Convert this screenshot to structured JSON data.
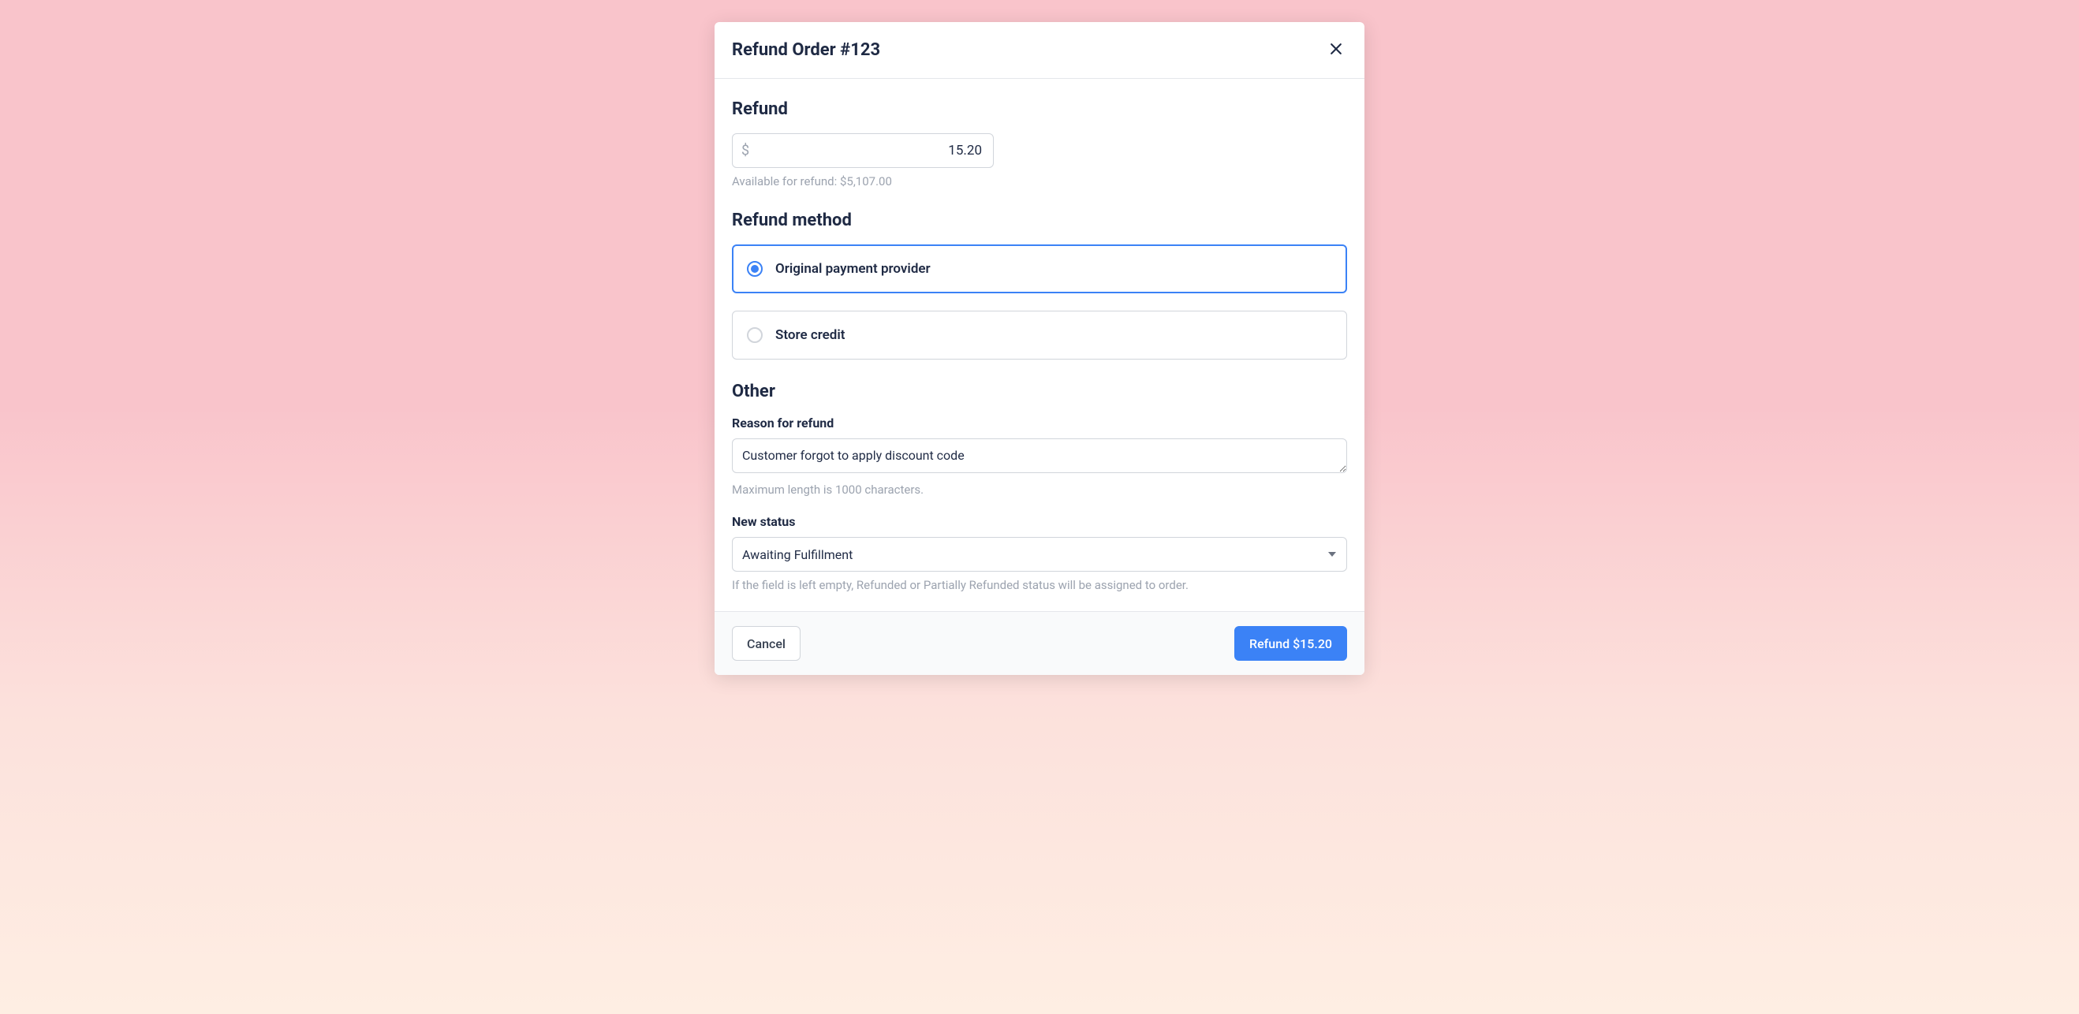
{
  "modal": {
    "title": "Refund Order #123",
    "sections": {
      "refund_title": "Refund",
      "method_title": "Refund method",
      "other_title": "Other"
    },
    "amount": {
      "currency_symbol": "$",
      "value": "15.20",
      "available_text": "Available for refund: $5,107.00"
    },
    "methods": {
      "original": "Original payment provider",
      "store_credit": "Store credit"
    },
    "reason": {
      "label": "Reason for refund",
      "value": "Customer forgot to apply discount code",
      "helper": "Maximum length is 1000 characters."
    },
    "status": {
      "label": "New status",
      "value": "Awaiting Fulfillment",
      "helper": "If the field is left empty, Refunded or Partially Refunded status will be assigned to order."
    },
    "footer": {
      "cancel": "Cancel",
      "submit": "Refund $15.20"
    }
  }
}
